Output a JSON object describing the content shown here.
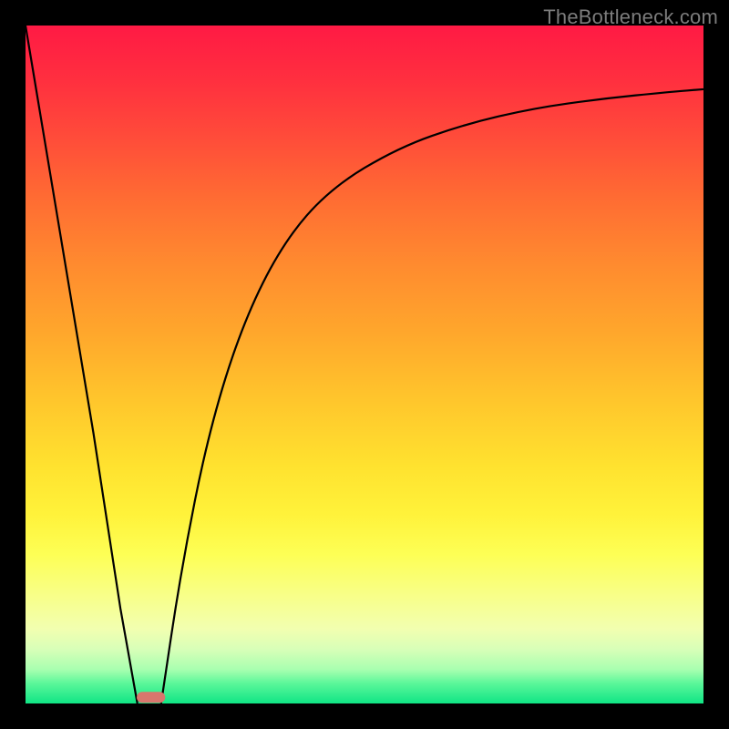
{
  "watermark": "TheBottleneck.com",
  "chart_data": {
    "type": "line",
    "title": "",
    "xlabel": "",
    "ylabel": "",
    "xlim": [
      0,
      100
    ],
    "ylim": [
      0,
      100
    ],
    "grid": false,
    "series": [
      {
        "name": "left-branch",
        "x": [
          0,
          5,
          10,
          14,
          16.5
        ],
        "values": [
          100,
          70,
          40,
          14,
          0
        ]
      },
      {
        "name": "right-branch",
        "x": [
          20,
          23,
          27,
          32,
          38,
          45,
          55,
          65,
          75,
          85,
          95,
          100
        ],
        "values": [
          0,
          20,
          40,
          56,
          68,
          76,
          82,
          85.5,
          87.8,
          89.2,
          90.2,
          90.6
        ]
      }
    ],
    "marker": {
      "name": "bottleneck-zone",
      "x_center": 18.5,
      "width": 4.2,
      "y": 0.9
    },
    "background_gradient": {
      "stops": [
        {
          "pos": 0,
          "color": "#ff1a44"
        },
        {
          "pos": 0.5,
          "color": "#ffc52c"
        },
        {
          "pos": 0.8,
          "color": "#fcff60"
        },
        {
          "pos": 1,
          "color": "#10e585"
        }
      ]
    }
  }
}
